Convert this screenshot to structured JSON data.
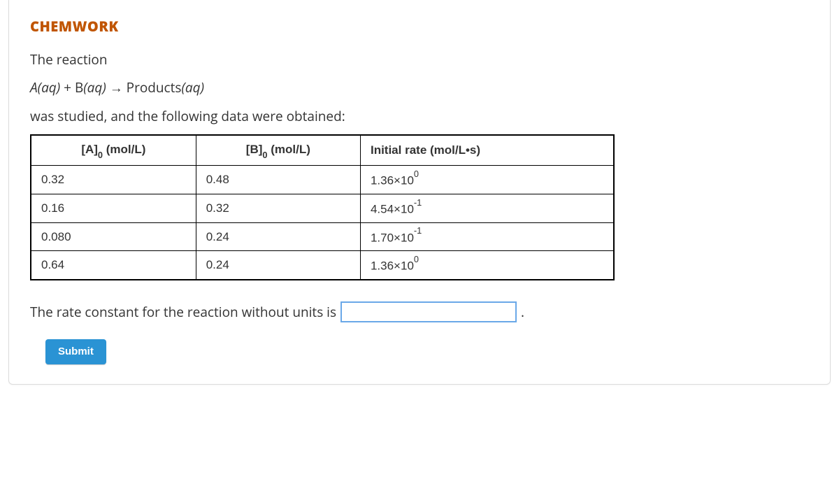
{
  "heading": "CHEMWORK",
  "intro_line1": "The reaction",
  "equation": {
    "pre": "A",
    "aq1": "(aq)",
    "plus": " + B",
    "aq2": "(aq)",
    "arrow": " → Products",
    "aq3": "(aq)"
  },
  "intro_line2": "was studied, and the following data were obtained:",
  "table": {
    "headers": {
      "a_pre": "[A]",
      "a_sub": "0",
      "a_post": " (mol/L)",
      "b_pre": "[B]",
      "b_sub": "0",
      "b_post": " (mol/L)",
      "rate": "Initial rate (mol/L•s)"
    },
    "rows": [
      {
        "a": "0.32",
        "b": "0.48",
        "rate_mant": "1.36×10",
        "rate_exp": "0"
      },
      {
        "a": "0.16",
        "b": "0.32",
        "rate_mant": "4.54×10",
        "rate_exp": "-1"
      },
      {
        "a": "0.080",
        "b": "0.24",
        "rate_mant": "1.70×10",
        "rate_exp": "-1"
      },
      {
        "a": "0.64",
        "b": "0.24",
        "rate_mant": "1.36×10",
        "rate_exp": "0"
      }
    ]
  },
  "prompt": "The rate constant for the reaction without units is",
  "input_value": "",
  "period": ".",
  "submit_label": "Submit"
}
